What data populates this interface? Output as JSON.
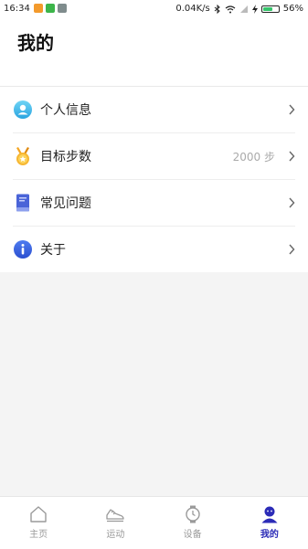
{
  "status_bar": {
    "time": "16:34",
    "network_speed": "0.04K/s",
    "battery": "56%",
    "battery_level": 0.56,
    "notification_icons": [
      "orange-app-icon",
      "green-app-icon",
      "gray-app-icon"
    ]
  },
  "header": {
    "title": "我的"
  },
  "menu": {
    "items": [
      {
        "label": "个人信息",
        "icon": "user-info-icon",
        "value": ""
      },
      {
        "label": "目标步数",
        "icon": "medal-icon",
        "value": "2000 步"
      },
      {
        "label": "常见问题",
        "icon": "book-icon",
        "value": ""
      },
      {
        "label": "关于",
        "icon": "info-icon",
        "value": ""
      }
    ]
  },
  "tabbar": {
    "tabs": [
      {
        "label": "主页",
        "icon": "home-icon",
        "active": false
      },
      {
        "label": "运动",
        "icon": "shoe-icon",
        "active": false
      },
      {
        "label": "设备",
        "icon": "watch-icon",
        "active": false
      },
      {
        "label": "我的",
        "icon": "profile-icon",
        "active": true
      }
    ],
    "active_color": "#2b2bb7",
    "inactive_color": "#9a9a9a"
  }
}
